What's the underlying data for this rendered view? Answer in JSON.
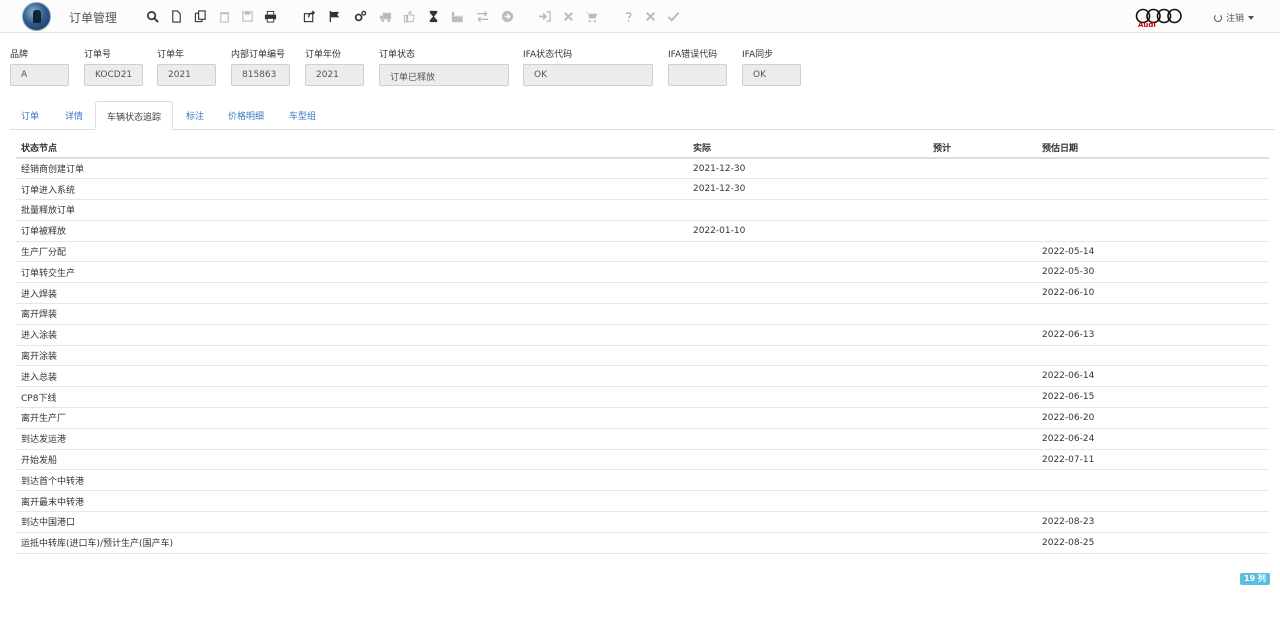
{
  "header": {
    "title": "订单管理",
    "brand_name": "Audi",
    "logout_label": "注销",
    "toolbar_icons": [
      "search-icon",
      "new-file-icon",
      "copy-icon",
      "delete-icon",
      "save-icon",
      "print-icon",
      "share-icon",
      "flag-icon",
      "settings-icon",
      "truck-icon",
      "thumbs-up-icon",
      "hourglass-icon",
      "factory-icon",
      "swap-icon",
      "arrow-circle-icon",
      "sign-in-icon",
      "close-icon",
      "cart-icon",
      "help-icon",
      "cancel-icon",
      "check-icon"
    ]
  },
  "fields": [
    {
      "label": "品牌",
      "value": "A"
    },
    {
      "label": "订单号",
      "value": "KOCD21"
    },
    {
      "label": "订单年",
      "value": "2021"
    },
    {
      "label": "内部订单编号",
      "value": "815863"
    },
    {
      "label": "订单年份",
      "value": "2021"
    },
    {
      "label": "订单状态",
      "value": "订单已释放"
    },
    {
      "label": "IFA状态代码",
      "value": "OK"
    },
    {
      "label": "IFA错误代码",
      "value": ""
    },
    {
      "label": "IFA同步",
      "value": "OK"
    }
  ],
  "tabs": [
    {
      "label": "订单"
    },
    {
      "label": "详情"
    },
    {
      "label": "车辆状态追踪"
    },
    {
      "label": "标注"
    },
    {
      "label": "价格明细"
    },
    {
      "label": "车型组"
    }
  ],
  "active_tab": "车辆状态追踪",
  "table": {
    "columns": [
      "状态节点",
      "实际",
      "预计",
      "预估日期"
    ],
    "rows": [
      [
        "经销商创建订单",
        "2021-12-30",
        "",
        ""
      ],
      [
        "订单进入系统",
        "2021-12-30",
        "",
        ""
      ],
      [
        "批量释放订单",
        "",
        "",
        ""
      ],
      [
        "订单被释放",
        "2022-01-10",
        "",
        ""
      ],
      [
        "生产厂分配",
        "",
        "",
        "2022-05-14"
      ],
      [
        "订单转交生产",
        "",
        "",
        "2022-05-30"
      ],
      [
        "进入焊装",
        "",
        "",
        "2022-06-10"
      ],
      [
        "离开焊装",
        "",
        "",
        ""
      ],
      [
        "进入涂装",
        "",
        "",
        "2022-06-13"
      ],
      [
        "离开涂装",
        "",
        "",
        ""
      ],
      [
        "进入总装",
        "",
        "",
        "2022-06-14"
      ],
      [
        "CP8下线",
        "",
        "",
        "2022-06-15"
      ],
      [
        "离开生产厂",
        "",
        "",
        "2022-06-20"
      ],
      [
        "到达发运港",
        "",
        "",
        "2022-06-24"
      ],
      [
        "开始发船",
        "",
        "",
        "2022-07-11"
      ],
      [
        "到达首个中转港",
        "",
        "",
        ""
      ],
      [
        "离开最末中转港",
        "",
        "",
        ""
      ],
      [
        "到达中国港口",
        "",
        "",
        "2022-08-23"
      ],
      [
        "运抵中转库(进口车)/预计生产(国产车)",
        "",
        "",
        "2022-08-25"
      ]
    ]
  },
  "footer": {
    "row_count_label": "19 列"
  },
  "colors": {
    "accent": "#3a78c2",
    "badge": "#5bc0de",
    "brand": "#cc0000"
  }
}
